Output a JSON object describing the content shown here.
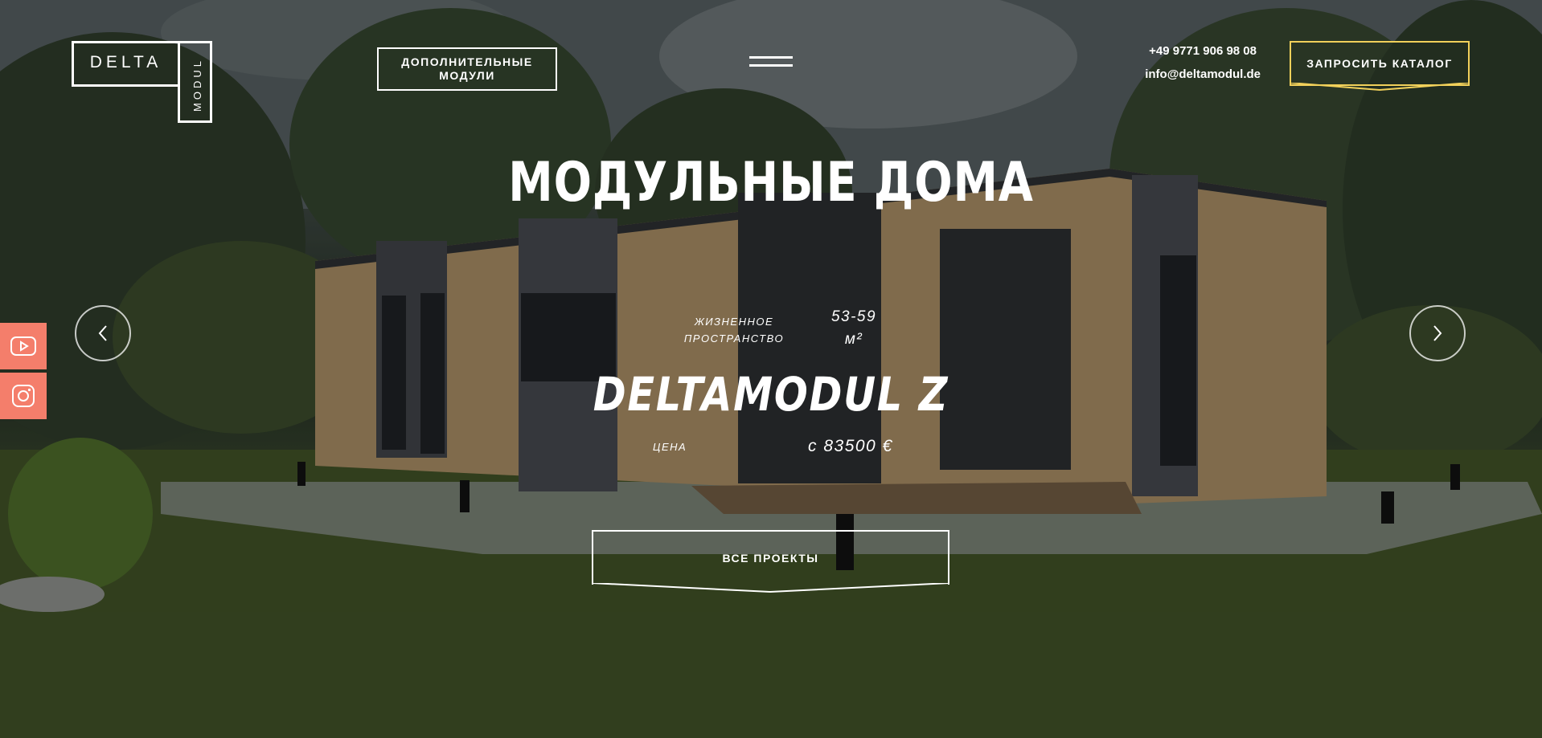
{
  "logo": {
    "word1": "DELTA",
    "word2": "MODUL"
  },
  "nav": {
    "modules_button": "ДОПОЛНИТЕЛЬНЫЕ\nМОДУЛИ",
    "catalog_button": "ЗАПРОСИТЬ КАТАЛОГ",
    "phone": "+49 9771 906 98 08",
    "email": "info@deltamodul.de"
  },
  "hero": {
    "title": "МОДУЛЬНЫЕ ДОМА",
    "living_space_label": "ЖИЗНЕННОЕ\nПРОСТРАНСТВО",
    "living_space_value": "53-59",
    "living_space_unit": "м²",
    "model_name": "DELTAMODUL Z",
    "price_label": "ЦЕНА",
    "price_value": "с 83500 €",
    "projects_button": "ВСЕ ПРОЕКТЫ"
  },
  "colors": {
    "catalog_border": "#f1d05a",
    "social_bg": "#f47e6b"
  },
  "icons": {
    "social": [
      "youtube-icon",
      "instagram-icon"
    ],
    "slider": [
      "chevron-left-icon",
      "chevron-right-icon"
    ],
    "menu": "hamburger-menu-icon"
  }
}
